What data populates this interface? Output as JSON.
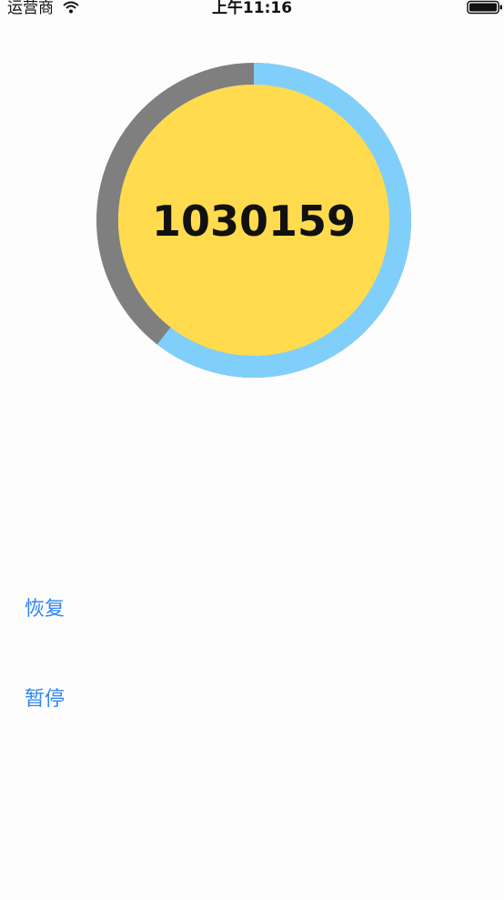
{
  "status_bar": {
    "carrier": "运营商",
    "time": "上午11:16",
    "wifi_icon": "wifi-icon",
    "battery_icon": "battery-icon"
  },
  "timer": {
    "value": "1030159",
    "progress": 0.605,
    "colors": {
      "progress": "#80cffb",
      "track": "#7f7f7f",
      "face": "#ffdb4d"
    }
  },
  "controls": {
    "resume_label": "恢复",
    "pause_label": "暂停",
    "link_color": "#2e86f5"
  }
}
